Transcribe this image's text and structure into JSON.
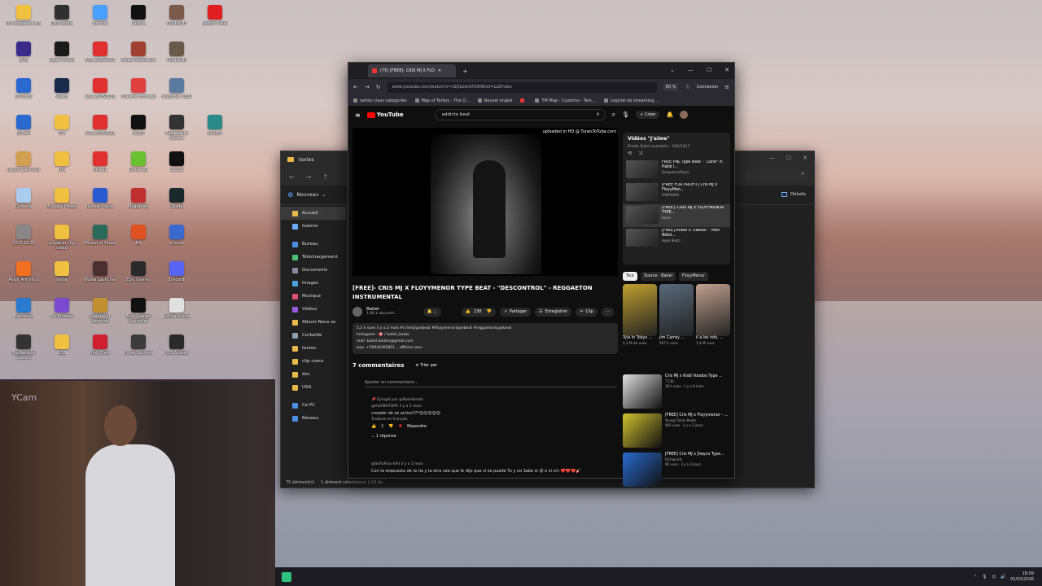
{
  "desktop": {
    "icons": [
      {
        "label": "59 Instagram_IEM",
        "color": "#f0c040",
        "col": 0,
        "row": 0
      },
      {
        "label": "OBS Studio",
        "color": "#303030",
        "col": 1,
        "row": 0
      },
      {
        "label": "Fortnite",
        "color": "#4aa0ff",
        "col": 2,
        "row": 0
      },
      {
        "label": "CapCut",
        "color": "#111111",
        "col": 3,
        "row": 0
      },
      {
        "label": "P1010637",
        "color": "#7a5a4a",
        "col": 4,
        "row": 0
      },
      {
        "label": "Betclic Poker",
        "color": "#e02020",
        "col": 5,
        "row": 0
      },
      {
        "label": "DUO",
        "color": "#3a2a8a",
        "col": 0,
        "row": 1
      },
      {
        "label": "Razer Cortex",
        "color": "#1a1a1a",
        "col": 1,
        "row": 1
      },
      {
        "label": "IMG_20250103",
        "color": "#e03030",
        "col": 2,
        "row": 1
      },
      {
        "label": "Wuwa Revolution",
        "color": "#a04030",
        "col": 3,
        "row": 1
      },
      {
        "label": "P1010636",
        "color": "#6a5a4a",
        "col": 4,
        "row": 1
      },
      {
        "label": "DVCurtis",
        "color": "#2a6ad0",
        "col": 0,
        "row": 2
      },
      {
        "label": "Steam",
        "color": "#1a2a4a",
        "col": 1,
        "row": 2
      },
      {
        "label": "IMG_20250102",
        "color": "#e03030",
        "col": 2,
        "row": 2
      },
      {
        "label": "CCleaner Browser",
        "color": "#e04040",
        "col": 3,
        "row": 2
      },
      {
        "label": "Snapchat 1830",
        "color": "#5a7aa0",
        "col": 4,
        "row": 2
      },
      {
        "label": "EVCam",
        "color": "#2a6ad0",
        "col": 0,
        "row": 3
      },
      {
        "label": "GTA",
        "color": "#f0c040",
        "col": 1,
        "row": 3
      },
      {
        "label": "IMG_20250101",
        "color": "#e03030",
        "col": 2,
        "row": 3
      },
      {
        "label": "FACEIT",
        "color": "#111111",
        "col": 3,
        "row": 3
      },
      {
        "label": "Battlestate Games",
        "color": "#333333",
        "col": 4,
        "row": 3
      },
      {
        "label": "SCRESP",
        "color": "#2a8a8a",
        "col": 5,
        "row": 3
      },
      {
        "label": "Habbo Launcher",
        "color": "#d0a050",
        "col": 0,
        "row": 4
      },
      {
        "label": "Eros",
        "color": "#f0c040",
        "col": 1,
        "row": 4
      },
      {
        "label": "Amelia",
        "color": "#e03030",
        "col": 2,
        "row": 4
      },
      {
        "label": "Divine 2D",
        "color": "#6ac030",
        "col": 3,
        "row": 4
      },
      {
        "label": "CapCut",
        "color": "#111111",
        "col": 4,
        "row": 4
      },
      {
        "label": "Corbeille",
        "color": "#aaccee",
        "col": 0,
        "row": 5
      },
      {
        "label": "Musique Projets",
        "color": "#f0c040",
        "col": 1,
        "row": 5
      },
      {
        "label": "Roblox Player",
        "color": "#2a5ad0",
        "col": 2,
        "row": 5
      },
      {
        "label": "Megabonk",
        "color": "#c03030",
        "col": 3,
        "row": 5
      },
      {
        "label": "Citadel",
        "color": "#1a2a2a",
        "col": 4,
        "row": 5
      },
      {
        "label": "2025-0128",
        "color": "#888888",
        "col": 0,
        "row": 6
      },
      {
        "label": "projet et clip video",
        "color": "#f0c040",
        "col": 1,
        "row": 6
      },
      {
        "label": "Wizard of Fanon",
        "color": "#2a6a5a",
        "col": 2,
        "row": 6
      },
      {
        "label": "EA",
        "color": "#e05020",
        "col": 3,
        "row": 6
      },
      {
        "label": "Vivaldi",
        "color": "#3a6ad0",
        "col": 4,
        "row": 6
      },
      {
        "label": "Avast Antivirus",
        "color": "#f07020",
        "col": 0,
        "row": 7
      },
      {
        "label": "texte",
        "color": "#f0c040",
        "col": 1,
        "row": 7
      },
      {
        "label": "Wuwa Launcher",
        "color": "#4a3030",
        "col": 2,
        "row": 7
      },
      {
        "label": "Epic Games",
        "color": "#2a2a2a",
        "col": 3,
        "row": 7
      },
      {
        "label": "Discord",
        "color": "#5865f2",
        "col": 4,
        "row": 7
      },
      {
        "label": "Battle.net",
        "color": "#2a7ad0",
        "col": 0,
        "row": 8
      },
      {
        "label": "Tor Browser",
        "color": "#7a4ad0",
        "col": 1,
        "row": 8
      },
      {
        "label": "League of Legends",
        "color": "#c09030",
        "col": 2,
        "row": 8
      },
      {
        "label": "Epic Games Launcher",
        "color": "#111111",
        "col": 3,
        "row": 8
      },
      {
        "label": "Roblox Studio",
        "color": "#e0e0e0",
        "col": 4,
        "row": 8
      },
      {
        "label": "Battlestate Games",
        "color": "#333333",
        "col": 0,
        "row": 9
      },
      {
        "label": "USB",
        "color": "#f0c040",
        "col": 1,
        "row": 9
      },
      {
        "label": "Riot Client",
        "color": "#d02030",
        "col": 2,
        "row": 9
      },
      {
        "label": "Cities Skylines",
        "color": "#3a3a3a",
        "col": 3,
        "row": 9
      },
      {
        "label": "OBS Screen",
        "color": "#2a2a2a",
        "col": 4,
        "row": 9
      }
    ]
  },
  "webcam": {
    "label": "YCam"
  },
  "explorer": {
    "title": "textes",
    "new_label": "Nouveau",
    "details_label": "Détails",
    "sidebar": [
      {
        "label": "Accueil",
        "color": "#e8b84a",
        "active": true
      },
      {
        "label": "Galerie",
        "color": "#6ab0ff",
        "active": false
      },
      {
        "label": "Bureau",
        "color": "#4a90e0",
        "active": false
      },
      {
        "label": "Téléchargement",
        "color": "#4ac070",
        "active": false
      },
      {
        "label": "Documents",
        "color": "#8a8aa0",
        "active": false
      },
      {
        "label": "Images",
        "color": "#4aa0e0",
        "active": false
      },
      {
        "label": "Musique",
        "color": "#e05070",
        "active": false
      },
      {
        "label": "Vidéos",
        "color": "#9a5ae0",
        "active": false
      },
      {
        "label": "Album-Nous so",
        "color": "#e8b84a",
        "active": false
      },
      {
        "label": "Corbeille",
        "color": "#8aa0b0",
        "active": false
      },
      {
        "label": "textes",
        "color": "#e8b84a",
        "active": false
      },
      {
        "label": "clip coeur",
        "color": "#e8b84a",
        "active": false
      },
      {
        "label": "doc",
        "color": "#e8b84a",
        "active": false
      },
      {
        "label": "USA",
        "color": "#e8b84a",
        "active": false
      },
      {
        "label": "Ce PC",
        "color": "#4a90e0",
        "active": false
      },
      {
        "label": "Réseau",
        "color": "#4a90e0",
        "active": false
      }
    ],
    "status_count": "75 élément(s)",
    "status_sel": "1 élément sélectionné  1,02 Ko"
  },
  "browser": {
    "tab_title": "(75) [FREE]- CRIS MJ X FLO",
    "url": "www.youtube.com/watch?v=xSQbzwmP2908list=LL8index",
    "zoom": "80 %",
    "connexion": "Connexion",
    "bookmarks": [
      "tarkov class categories",
      "Map of Tarkov - The O...",
      "Nouvel onglet",
      "",
      "TM Map - Customs - Tark...",
      "Logiciel de streaming ..."
    ]
  },
  "youtube": {
    "logo": "YouTube",
    "search": "addicto beat",
    "create": "Créer",
    "uploaded": "uploaded in HD @ TunesToTube.com",
    "title": "[FREE]- CRIS MJ X FLOYYMENOR TYPE BEAT - \"DESCONTROL\" - REGGAETON INSTRUMENTAL",
    "channel": "Batiel",
    "subs": "1,08 k abonnés",
    "likes": "238",
    "share": "Partager",
    "save": "Enregistrer",
    "clip": "Clip",
    "desc_line1": "5,2 k vues  il y a 2 mois  #crismjtypebeat #floyymenortypebeat #reggaetontypebeat",
    "desc_line2": "Instagram : 🎯 / batiel_beats",
    "desc_line3": "mail: batiel.beatss@gmail.com",
    "desc_line4": "wsp: +56944302851  ...afficher plus",
    "comments_count": "7 commentaires",
    "sort": "Trier par",
    "add_comment": "Ajouter un commentaire...",
    "c1_pinned": "📌 Épinglé par @Batielbeats",
    "c1_author": "@ALONSITOPR  il y a 2 mois",
    "c1_text": "creador de se activo???😊😊😊😊😊",
    "c1_translate": "Traduire en français",
    "c1_reply": "Répondre",
    "c1_likes": "1",
    "c1_replies": "1 réponse",
    "c2_author": "@SofiaRios-k9d  il y a 1 mois",
    "c2_text": "Con la respuesta de la tia y la otra vee que le dijo que si se puede Tu y no Sabe si 😡 o si cm ❤️❤️❤️🎸"
  },
  "playlist": {
    "title": "Vidéos \"J'aime\"",
    "sub": "Privée  Selim Lamabrix · 102/1417",
    "items": [
      {
        "title": "FREE PNL Type Beat - \"Zoné\" ft. Hatik l...",
        "channel": "DespotovicMusic",
        "dur": "4:02",
        "current": false
      },
      {
        "title": "[FREE FOR PROFIT] Cris MJ x FloyyMen...",
        "channel": "FANTASMA",
        "dur": "3:22",
        "current": false
      },
      {
        "title": "[FREE]- CRIS MJ X FLOYYMENOR TYPE...",
        "channel": "Batiel",
        "dur": "2:55",
        "current": true
      },
      {
        "title": "[FREE] RnBoi x Tiakola - \"Mon Bébé...",
        "channel": "Hype Beatz",
        "dur": "2:34",
        "current": false
      }
    ]
  },
  "chips": [
    "Tout",
    "Source : Batiel",
    "FloyyMenor"
  ],
  "shorts": [
    {
      "title": "Tyla in Tokyo ...",
      "views": "2,3 M de vues",
      "color": "#c0a030"
    },
    {
      "title": "Jim Carrey ...",
      "views": "507 k vues",
      "color": "#5a6a7a"
    },
    {
      "title": "Il a les refs, ...",
      "views": "1,4 M vues",
      "color": "#c0a090"
    }
  ],
  "recs": [
    {
      "title": "Cris MJ x Kidd Voodoo Type ...",
      "channel": "7 CEL",
      "meta": "38 k vues · il y a 8 mois",
      "dur": "3:26",
      "color": "#e0e0e0"
    },
    {
      "title": "[FREE] Cris MJ x Floyymenor - ...",
      "channel": "Young Flame Beats",
      "meta": "982 vues · il y a 3 jours",
      "dur": "2:15",
      "color": "#d0c030"
    },
    {
      "title": "[FREE] Cris MJ x Jhayco Type...",
      "channel": "Richiprodz",
      "meta": "96 vues · il y a 3 jours",
      "dur": "",
      "color": "#2a6ad0"
    }
  ],
  "tray": {
    "time": "18:09",
    "date": "01/03/2026"
  }
}
